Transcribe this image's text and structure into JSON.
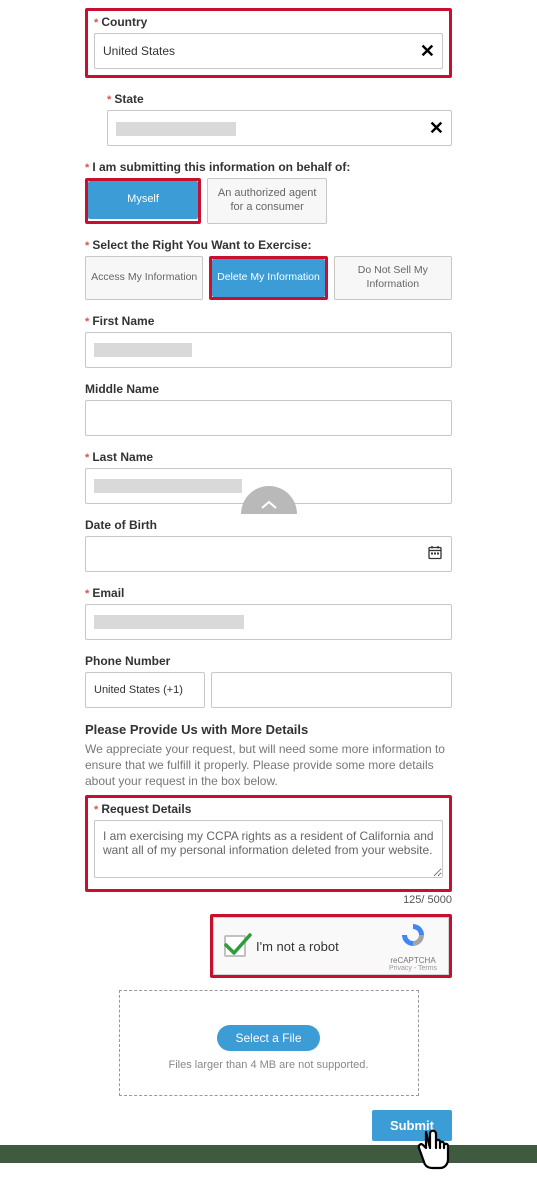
{
  "country": {
    "label": "Country",
    "value": "United States"
  },
  "state": {
    "label": "State",
    "value": ""
  },
  "behalf": {
    "label": "I am submitting this information on behalf of:",
    "options": [
      {
        "label": "Myself",
        "selected": true
      },
      {
        "label": "An authorized agent for a consumer",
        "selected": false
      }
    ]
  },
  "right": {
    "label": "Select the Right You Want to Exercise:",
    "options": [
      {
        "label": "Access My Information",
        "selected": false
      },
      {
        "label": "Delete My Information",
        "selected": true
      },
      {
        "label": "Do Not Sell My Information",
        "selected": false
      }
    ]
  },
  "first_name": {
    "label": "First Name"
  },
  "middle_name": {
    "label": "Middle Name"
  },
  "last_name": {
    "label": "Last Name"
  },
  "dob": {
    "label": "Date of Birth"
  },
  "email": {
    "label": "Email"
  },
  "phone": {
    "label": "Phone Number",
    "code": "United States (+1)"
  },
  "more_details": {
    "title": "Please Provide Us with More Details",
    "help": "We appreciate your request, but will need some more information to ensure that we fulfill it properly. Please provide some more details about your request in the box below."
  },
  "request_details": {
    "label": "Request Details",
    "value": "I am exercising my CCPA rights as a resident of California and want all of my personal information deleted from your website.",
    "counter": "125/ 5000"
  },
  "recaptcha": {
    "text": "I'm not a robot",
    "brand": "reCAPTCHA",
    "terms": "Privacy - Terms"
  },
  "upload": {
    "button": "Select a File",
    "hint": "Files larger than 4 MB are not supported."
  },
  "submit": {
    "label": "Submit"
  }
}
